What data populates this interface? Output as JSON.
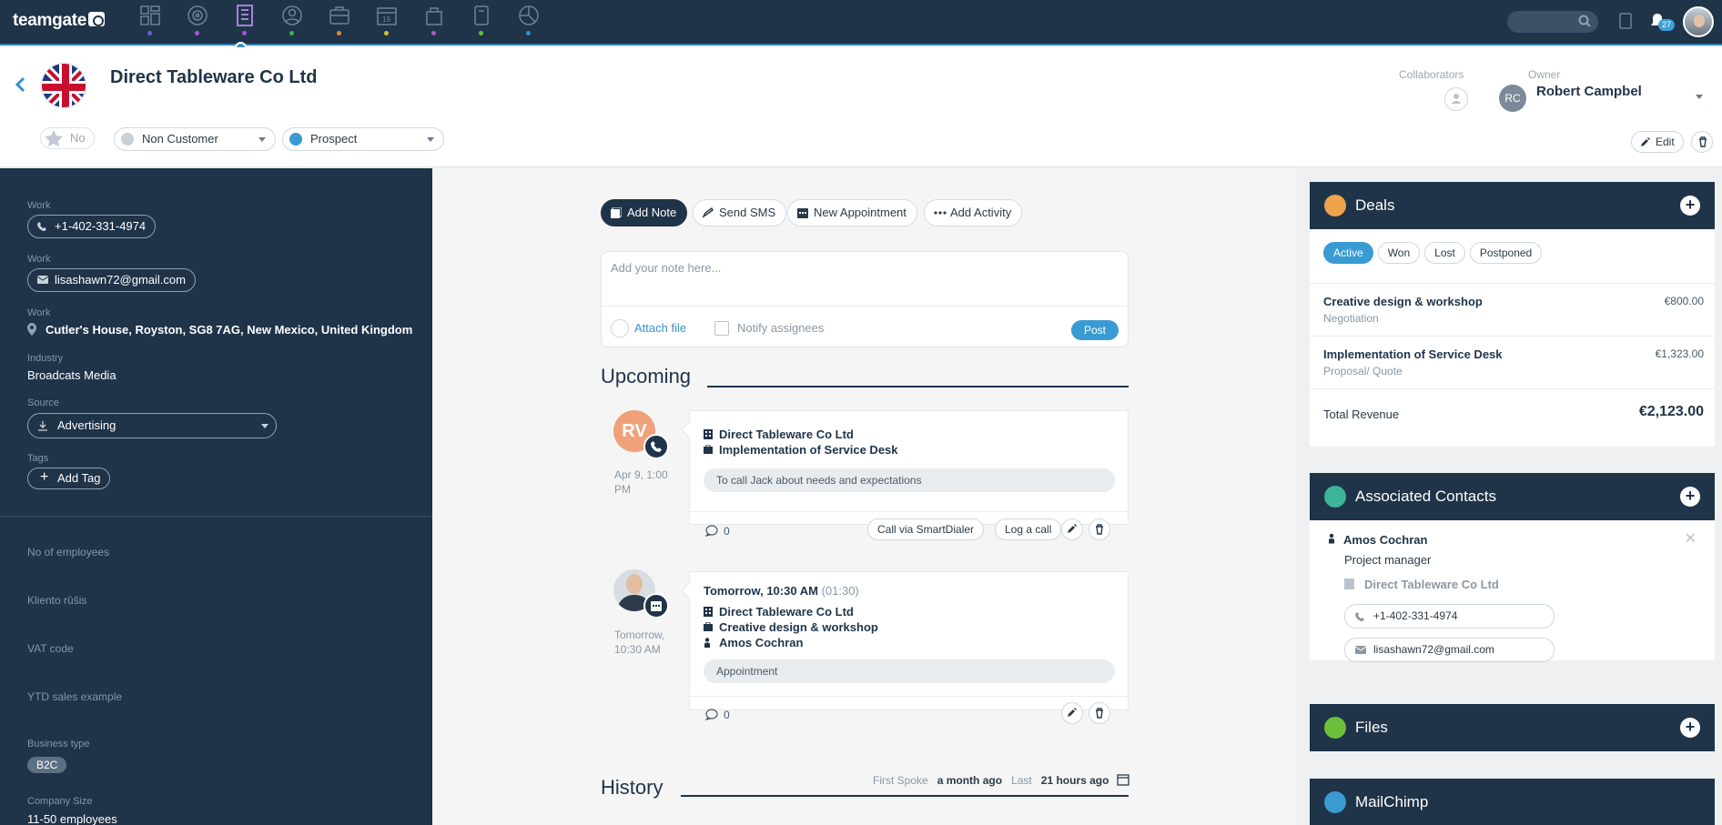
{
  "app": {
    "logo": "teamgate",
    "notification_count": "27"
  },
  "company": {
    "name": "Direct Tableware Co Ltd",
    "favorite_label": "No",
    "status": "Non Customer",
    "stage": "Prospect",
    "collaborators_label": "Collaborators",
    "owner_label": "Owner",
    "owner_initials": "RC",
    "owner_name": "Robert Campbel",
    "edit_label": "Edit"
  },
  "left": {
    "work_label": "Work",
    "phone": "+1-402-331-4974",
    "email": "lisashawn72@gmail.com",
    "address": "Cutler's House, Royston, SG8 7AG, New Mexico, United Kingdom",
    "industry_label": "Industry",
    "industry": "Broadcats Media",
    "source_label": "Source",
    "source": "Advertising",
    "tags_label": "Tags",
    "add_tag": "Add Tag",
    "fields": [
      "No of employees",
      "Kliento rūšis",
      "VAT code",
      "YTD sales example"
    ],
    "business_type_label": "Business type",
    "business_type": "B2C",
    "company_size_label": "Company Size",
    "company_size": "11-50 employees"
  },
  "actions": {
    "add_note": "Add Note",
    "send_sms": "Send SMS",
    "new_appointment": "New Appointment",
    "add_activity": "Add Activity"
  },
  "note": {
    "placeholder": "Add your note here...",
    "attach": "Attach file",
    "notify": "Notify assignees",
    "post": "Post"
  },
  "upcoming": {
    "title": "Upcoming",
    "items": [
      {
        "avatar_initials": "RV",
        "date": "Apr 9, 1:00 PM",
        "company": "Direct Tableware Co Ltd",
        "deal": "Implementation of Service Desk",
        "note": "To call Jack about needs and expectations",
        "comments": "0",
        "btn_call": "Call via SmartDialer",
        "btn_log": "Log a call"
      },
      {
        "date": "Tomorrow, 10:30 AM",
        "header": "Tomorrow, 10:30 AM",
        "duration": "(01:30)",
        "company": "Direct Tableware Co Ltd",
        "deal": "Creative design & workshop",
        "contact": "Amos Cochran",
        "note": "Appointment",
        "comments": "0"
      }
    ]
  },
  "history": {
    "title": "History",
    "first_spoke_label": "First Spoke",
    "first_spoke": "a month ago",
    "last_label": "Last",
    "last": "21 hours ago"
  },
  "deals": {
    "title": "Deals",
    "tabs": [
      "Active",
      "Won",
      "Lost",
      "Postponed"
    ],
    "items": [
      {
        "name": "Creative design & workshop",
        "stage": "Negotiation",
        "amount": "€800.00"
      },
      {
        "name": "Implementation of Service Desk",
        "stage": "Proposal/ Quote",
        "amount": "€1,323.00"
      }
    ],
    "total_label": "Total Revenue",
    "total": "€2,123.00"
  },
  "contacts": {
    "title": "Associated Contacts",
    "name": "Amos Cochran",
    "role": "Project manager",
    "company": "Direct Tableware Co Ltd",
    "phone": "+1-402-331-4974",
    "email": "lisashawn72@gmail.com"
  },
  "files": {
    "title": "Files"
  },
  "mailchimp": {
    "title": "MailChimp"
  },
  "colors": {
    "navy": "#1f3349",
    "accent": "#3a9bd2",
    "deals_icon": "#f0a34a",
    "contacts_icon": "#3cb39a",
    "files_icon": "#6bbf3a",
    "mailchimp_icon": "#3a9bd2"
  }
}
